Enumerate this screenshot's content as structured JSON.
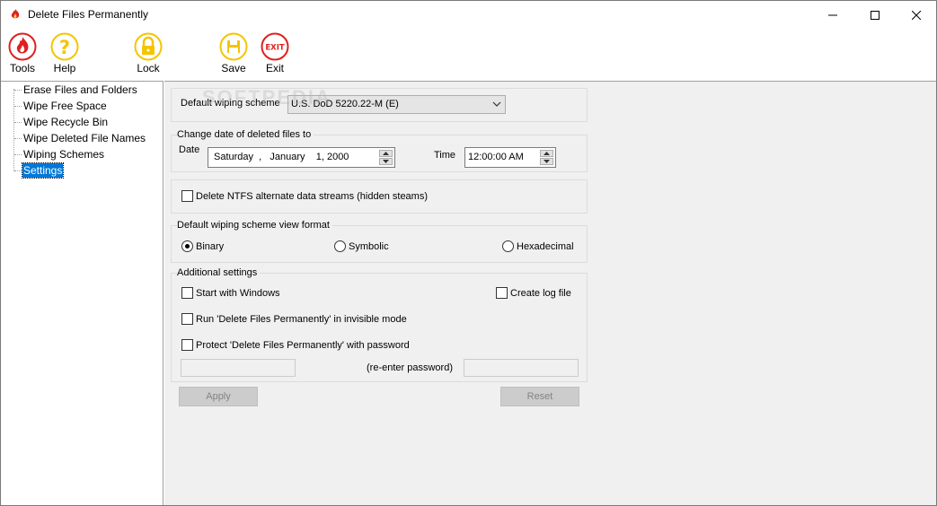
{
  "window": {
    "title": "Delete Files Permanently"
  },
  "toolbar": {
    "tools_label": "Tools",
    "help_label": "Help",
    "lock_label": "Lock",
    "save_label": "Save",
    "exit_label": "Exit",
    "exit_icon_text": "EXIT"
  },
  "tree": {
    "items": [
      {
        "label": "Erase Files and Folders"
      },
      {
        "label": "Wipe Free Space"
      },
      {
        "label": "Wipe Recycle Bin"
      },
      {
        "label": "Wipe Deleted File Names"
      },
      {
        "label": "Wiping Schemes"
      },
      {
        "label": "Settings",
        "selected": true
      }
    ]
  },
  "settings": {
    "wiping_scheme_label": "Default wiping scheme",
    "wiping_scheme_value": "U.S. DoD 5220.22-M (E)",
    "change_date_title": "Change date of deleted files to",
    "date_label": "Date",
    "date_value": "Saturday  ,   January    1, 2000",
    "time_label": "Time",
    "time_value": "12:00:00 AM",
    "ntfs_label": "Delete NTFS alternate data streams (hidden steams)",
    "view_format_title": "Default wiping scheme view format",
    "view_format_options": [
      "Binary",
      "Symbolic",
      "Hexadecimal"
    ],
    "view_format_selected": "Binary",
    "additional_title": "Additional settings",
    "start_with_windows": "Start with Windows",
    "create_log_file": "Create log file",
    "invisible_mode": "Run 'Delete Files Permanently' in invisible mode",
    "protect_password": "Protect 'Delete Files Permanently' with password",
    "reenter_password": "(re-enter password)",
    "apply_label": "Apply",
    "reset_label": "Reset"
  },
  "watermark": "SOFTPEDIA",
  "colors": {
    "selection": "#0078d7",
    "panel_bg": "#f0f0f0",
    "icon_red": "#e02020",
    "icon_yellow": "#f5c400"
  }
}
